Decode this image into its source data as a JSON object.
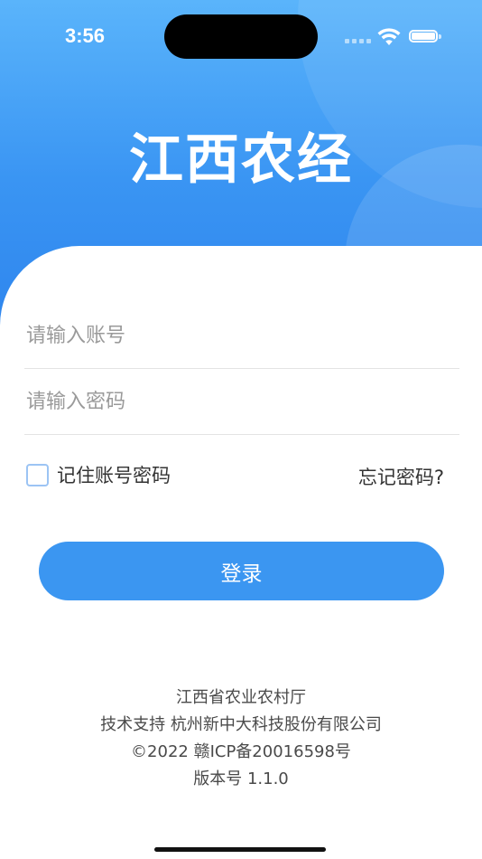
{
  "status_bar": {
    "time": "3:56"
  },
  "app": {
    "title": "江西农经"
  },
  "login": {
    "account_placeholder": "请输入账号",
    "account_value": "",
    "password_placeholder": "请输入密码",
    "password_value": "",
    "remember_label": "记住账号密码",
    "remember_checked": false,
    "forgot_label": "忘记密码?",
    "submit_label": "登录"
  },
  "footer": {
    "org": "江西省农业农村厅",
    "support": "技术支持 杭州新中大科技股份有限公司",
    "copyright": "©2022 赣ICP备20016598号",
    "version": "版本号 1.1.0"
  },
  "colors": {
    "primary": "#3b96f1",
    "header_top": "#5ab4fb",
    "header_bottom": "#2f86ee",
    "checkbox_border": "#9cc4f4"
  }
}
